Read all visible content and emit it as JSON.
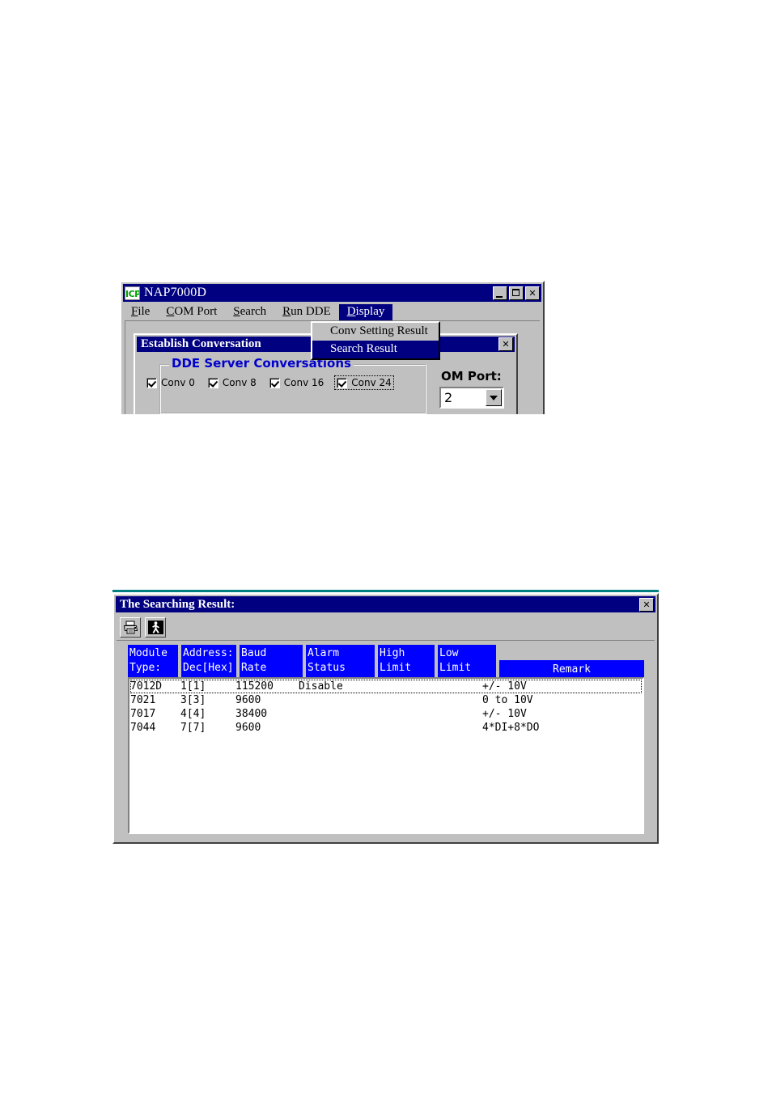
{
  "main_window": {
    "title": "NAP7000D",
    "logo_text": "ICP",
    "controls": {
      "minimize": "_",
      "maximize": "□",
      "close": "✕"
    },
    "menu": [
      {
        "label": "File",
        "accel": "F",
        "rest": "ile"
      },
      {
        "label": "COM Port",
        "accel": "C",
        "rest": "OM Port"
      },
      {
        "label": "Search",
        "accel": "S",
        "rest": "earch"
      },
      {
        "label": "Run DDE",
        "accel": "R",
        "rest": "un DDE"
      },
      {
        "label": "Display",
        "accel": "D",
        "rest": "isplay"
      }
    ],
    "dropdown": {
      "items": [
        {
          "label": "Conv Setting Result",
          "selected": false
        },
        {
          "label": "Search Result",
          "selected": true
        }
      ]
    },
    "conversation_dialog": {
      "title": "Establish Conversation",
      "close_label": "✕",
      "group_label": "DDE Server Conversations",
      "checkboxes": [
        {
          "label": "Conv 0",
          "checked": true,
          "focused": false
        },
        {
          "label": "Conv 8",
          "checked": true,
          "focused": false
        },
        {
          "label": "Conv 16",
          "checked": true,
          "focused": false
        },
        {
          "label": "Conv 24",
          "checked": true,
          "focused": true
        }
      ],
      "com_port_label": "OM Port:",
      "com_port_value": "2"
    }
  },
  "search_window": {
    "title": "The Searching Result:",
    "close_label": "✕",
    "toolbar": [
      {
        "name": "print-icon",
        "tooltip": "Print"
      },
      {
        "name": "exit-icon",
        "tooltip": "Exit"
      }
    ],
    "columns": [
      {
        "line1": "Module",
        "line2": "Type:"
      },
      {
        "line1": "Address:",
        "line2": "Dec[Hex]"
      },
      {
        "line1": "Baud",
        "line2": "Rate"
      },
      {
        "line1": "Alarm",
        "line2": "Status"
      },
      {
        "line1": "High",
        "line2": "Limit"
      },
      {
        "line1": "Low",
        "line2": "Limit"
      },
      {
        "line1": "",
        "line2": "Remark"
      }
    ],
    "rows": [
      {
        "module_type": "7012D",
        "address": "1[1]",
        "baud_rate": "115200",
        "alarm_status": "Disable",
        "high_limit": "",
        "low_limit": "",
        "remark": "+/- 10V",
        "focused": true
      },
      {
        "module_type": "7021",
        "address": "3[3]",
        "baud_rate": "9600",
        "alarm_status": "",
        "high_limit": "",
        "low_limit": "",
        "remark": "0 to 10V",
        "focused": false
      },
      {
        "module_type": "7017",
        "address": "4[4]",
        "baud_rate": "38400",
        "alarm_status": "",
        "high_limit": "",
        "low_limit": "",
        "remark": "+/- 10V",
        "focused": false
      },
      {
        "module_type": "7044",
        "address": "7[7]",
        "baud_rate": "9600",
        "alarm_status": "",
        "high_limit": "",
        "low_limit": "",
        "remark": "4*DI+8*DO",
        "focused": false
      }
    ]
  },
  "colors": {
    "titlebar": "#000080",
    "header_blue": "#0000ff",
    "group_label_blue": "#0000cc",
    "face": "#c0c0c0",
    "teal_edge": "#008080"
  }
}
